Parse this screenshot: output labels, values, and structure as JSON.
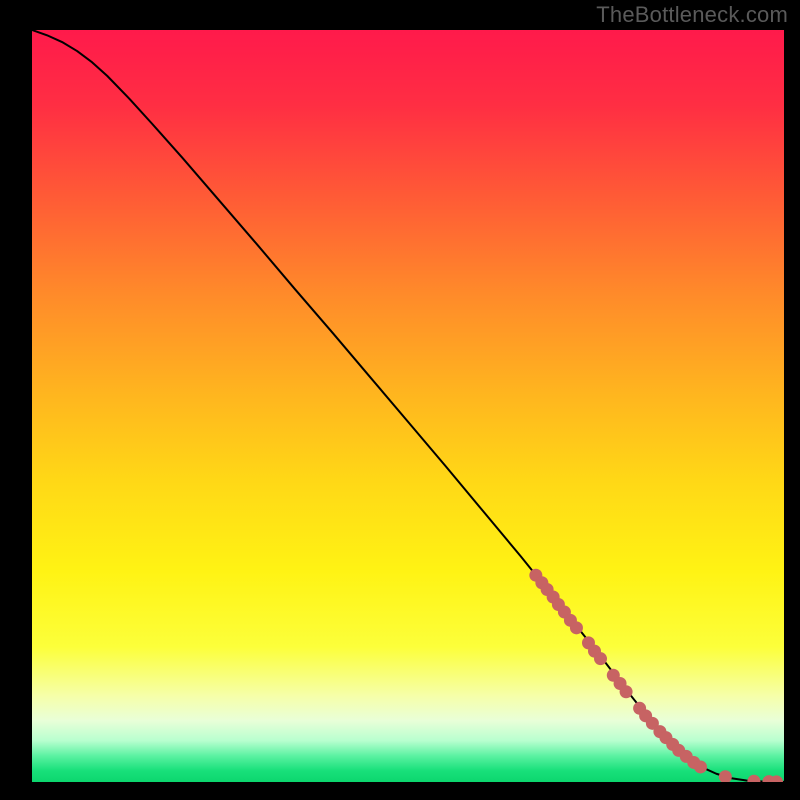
{
  "watermark": "TheBottleneck.com",
  "colors": {
    "background": "#000000",
    "curve": "#000000",
    "point": "#c76363",
    "gradient_stops": [
      {
        "offset": 0.0,
        "color": "#ff1a4b"
      },
      {
        "offset": 0.1,
        "color": "#ff2e43"
      },
      {
        "offset": 0.22,
        "color": "#ff5a36"
      },
      {
        "offset": 0.35,
        "color": "#ff8a2a"
      },
      {
        "offset": 0.48,
        "color": "#ffb41f"
      },
      {
        "offset": 0.6,
        "color": "#ffd816"
      },
      {
        "offset": 0.72,
        "color": "#fff314"
      },
      {
        "offset": 0.82,
        "color": "#fcff3a"
      },
      {
        "offset": 0.885,
        "color": "#f6ffa8"
      },
      {
        "offset": 0.918,
        "color": "#e9ffd8"
      },
      {
        "offset": 0.945,
        "color": "#b8ffcf"
      },
      {
        "offset": 0.965,
        "color": "#5cf2a2"
      },
      {
        "offset": 0.985,
        "color": "#18e07a"
      },
      {
        "offset": 1.0,
        "color": "#0cd66e"
      }
    ]
  },
  "chart_data": {
    "type": "line",
    "title": "",
    "xlabel": "",
    "ylabel": "",
    "xlim": [
      0,
      100
    ],
    "ylim": [
      0,
      100
    ],
    "grid": false,
    "legend": false,
    "series": [
      {
        "name": "curve",
        "kind": "line",
        "x": [
          0,
          2,
          4,
          6,
          8,
          10,
          13,
          16,
          20,
          25,
          30,
          35,
          40,
          45,
          50,
          55,
          60,
          65,
          70,
          73,
          76,
          79,
          82,
          85,
          87,
          89,
          91,
          93,
          95,
          97,
          99,
          100
        ],
        "y": [
          100,
          99.3,
          98.4,
          97.2,
          95.7,
          93.9,
          90.8,
          87.5,
          83.0,
          77.2,
          71.4,
          65.5,
          59.7,
          53.8,
          47.9,
          42.0,
          36.0,
          30.0,
          23.8,
          20.0,
          16.2,
          12.3,
          8.5,
          5.2,
          3.4,
          2.0,
          1.1,
          0.5,
          0.2,
          0.08,
          0.02,
          0.01
        ]
      },
      {
        "name": "data-points",
        "kind": "scatter",
        "x": [
          67.0,
          67.8,
          68.5,
          69.3,
          70.0,
          70.8,
          71.6,
          72.4,
          74.0,
          74.8,
          75.6,
          77.3,
          78.2,
          79.0,
          80.8,
          81.6,
          82.5,
          83.5,
          84.3,
          85.2,
          86.0,
          87.0,
          88.0,
          88.9,
          92.2,
          96.0,
          98.0,
          99.0
        ],
        "y": [
          27.5,
          26.5,
          25.6,
          24.6,
          23.6,
          22.6,
          21.5,
          20.5,
          18.5,
          17.4,
          16.4,
          14.2,
          13.1,
          12.0,
          9.8,
          8.8,
          7.8,
          6.7,
          5.9,
          5.0,
          4.2,
          3.4,
          2.6,
          2.0,
          0.7,
          0.1,
          0.05,
          0.02
        ]
      }
    ]
  }
}
